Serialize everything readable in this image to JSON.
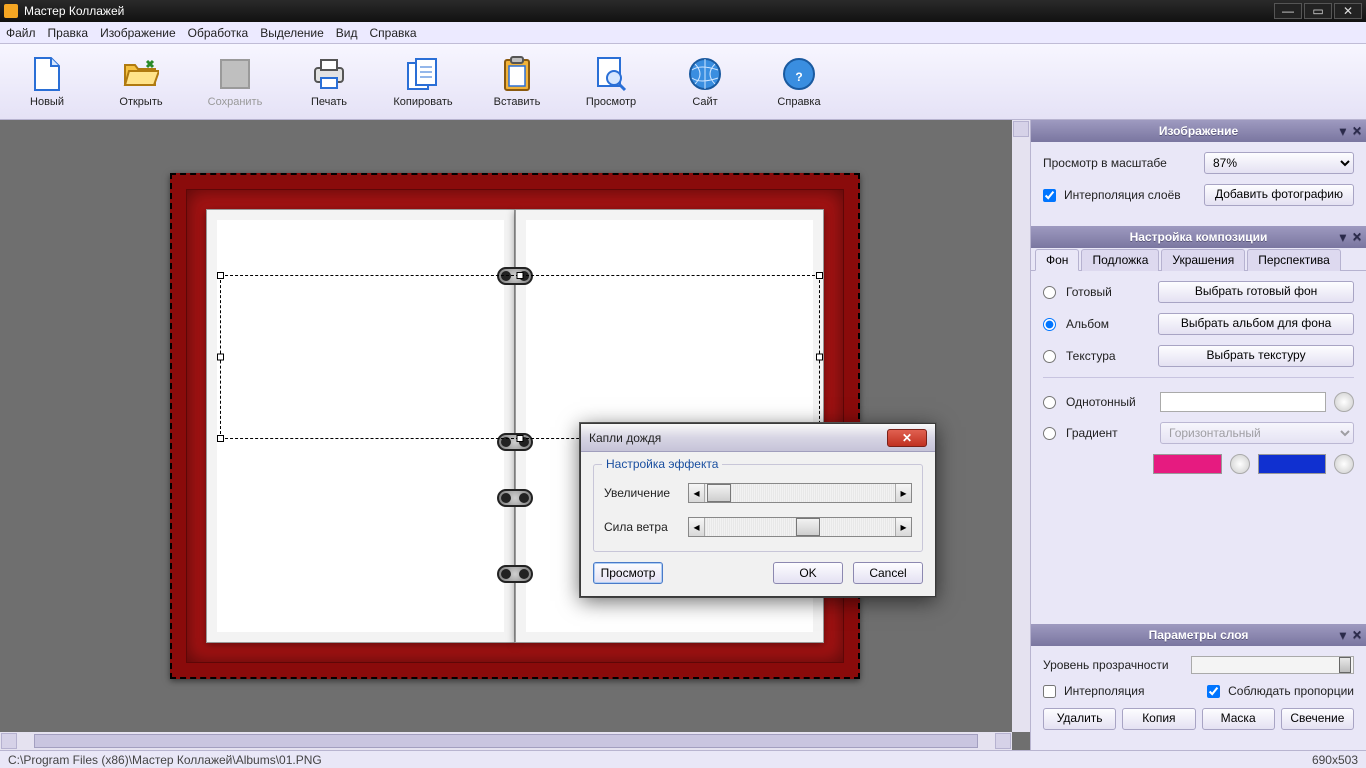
{
  "window": {
    "title": "Мастер Коллажей"
  },
  "menu": [
    "Файл",
    "Правка",
    "Изображение",
    "Обработка",
    "Выделение",
    "Вид",
    "Справка"
  ],
  "toolbar": [
    {
      "name": "new",
      "label": "Новый",
      "icon": "file-icon"
    },
    {
      "name": "open",
      "label": "Открыть",
      "icon": "folder-open-icon"
    },
    {
      "name": "save",
      "label": "Сохранить",
      "icon": "save-icon",
      "disabled": true
    },
    {
      "name": "print",
      "label": "Печать",
      "icon": "printer-icon"
    },
    {
      "name": "copy",
      "label": "Копировать",
      "icon": "copy-icon"
    },
    {
      "name": "paste",
      "label": "Вставить",
      "icon": "clipboard-icon"
    },
    {
      "name": "preview",
      "label": "Просмотр",
      "icon": "magnifier-icon"
    },
    {
      "name": "site",
      "label": "Сайт",
      "icon": "globe-icon"
    },
    {
      "name": "help",
      "label": "Справка",
      "icon": "help-icon"
    }
  ],
  "panels": {
    "image": {
      "title": "Изображение",
      "zoom_label": "Просмотр в масштабе",
      "zoom_value": "87%",
      "interp_label": "Интерполяция слоёв",
      "interp_checked": true,
      "add_photo": "Добавить фотографию"
    },
    "composition": {
      "title": "Настройка композиции",
      "tabs": [
        "Фон",
        "Подложка",
        "Украшения",
        "Перспектива"
      ],
      "active_tab": 0,
      "bg": {
        "ready_label": "Готовый",
        "ready_btn": "Выбрать готовый фон",
        "album_label": "Альбом",
        "album_btn": "Выбрать альбом для фона",
        "texture_label": "Текстура",
        "texture_btn": "Выбрать текстуру",
        "solid_label": "Однотонный",
        "gradient_label": "Градиент",
        "gradient_value": "Горизонтальный",
        "selected": "album"
      }
    },
    "layer": {
      "title": "Параметры слоя",
      "opacity_label": "Уровень прозрачности",
      "opacity_value": 100,
      "interp_label": "Интерполяция",
      "interp_checked": false,
      "aspect_label": "Соблюдать пропорции",
      "aspect_checked": true,
      "buttons": [
        "Удалить",
        "Копия",
        "Маска",
        "Свечение"
      ]
    }
  },
  "dialog": {
    "title": "Капли дождя",
    "group": "Настройка эффекта",
    "zoom_label": "Увеличение",
    "zoom_value": 5,
    "wind_label": "Сила ветра",
    "wind_value": 50,
    "preview": "Просмотр",
    "ok": "OK",
    "cancel": "Cancel"
  },
  "status": {
    "path": "C:\\Program Files (x86)\\Мастер Коллажей\\Albums\\01.PNG",
    "size": "690x503"
  }
}
